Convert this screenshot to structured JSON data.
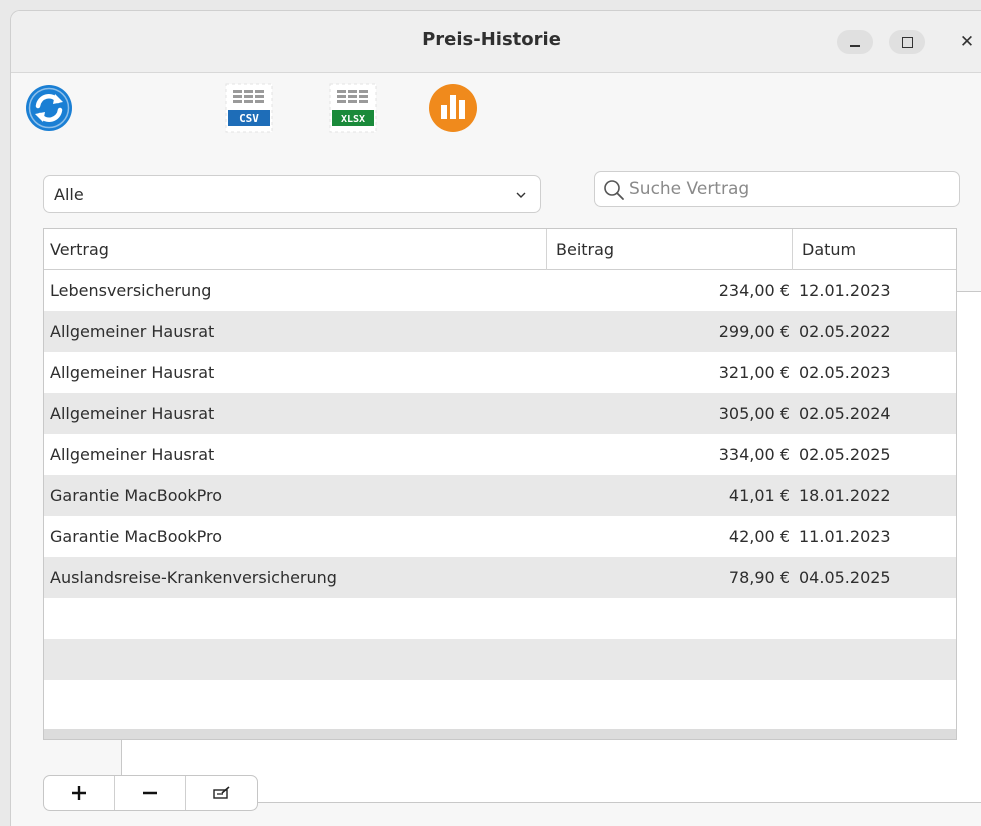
{
  "window": {
    "title": "Preis-Historie",
    "close_glyph": "✕"
  },
  "toolbar": {
    "buttons": [
      {
        "name": "refresh",
        "icon": "refresh-icon",
        "color": "#1a7fd4"
      },
      {
        "name": "table-view",
        "icon": "table-grid-icon",
        "color": "#2c6fd6"
      },
      {
        "name": "export-csv",
        "icon": "csv-export-icon",
        "label": "CSV",
        "color": "#1e6db8"
      },
      {
        "name": "export-xlsx",
        "icon": "xlsx-export-icon",
        "label": "XLSX",
        "color": "#1a8a3a"
      },
      {
        "name": "chart",
        "icon": "bar-chart-icon",
        "color": "#f08a1c"
      }
    ]
  },
  "filter": {
    "selected": "Alle"
  },
  "search": {
    "placeholder": "Suche Vertrag",
    "value": ""
  },
  "table": {
    "headers": [
      "Vertrag",
      "Beitrag",
      "Datum"
    ],
    "rows": [
      {
        "vertrag": "Lebensversicherung",
        "beitrag": "234,00 €",
        "datum": "12.01.2023"
      },
      {
        "vertrag": "Allgemeiner Hausrat",
        "beitrag": "299,00 €",
        "datum": "02.05.2022"
      },
      {
        "vertrag": "Allgemeiner Hausrat",
        "beitrag": "321,00 €",
        "datum": "02.05.2023"
      },
      {
        "vertrag": "Allgemeiner Hausrat",
        "beitrag": "305,00 €",
        "datum": "02.05.2024"
      },
      {
        "vertrag": "Allgemeiner Hausrat",
        "beitrag": "334,00 €",
        "datum": "02.05.2025"
      },
      {
        "vertrag": "Garantie MacBookPro",
        "beitrag": "41,01 €",
        "datum": "18.01.2022"
      },
      {
        "vertrag": "Garantie MacBookPro",
        "beitrag": "42,00 €",
        "datum": "11.01.2023"
      },
      {
        "vertrag": "Auslandsreise-Krankenversicherung",
        "beitrag": "78,90 €",
        "datum": "04.05.2025"
      }
    ],
    "empty_rows": 3
  },
  "actions": [
    {
      "name": "add",
      "icon": "plus-icon"
    },
    {
      "name": "remove",
      "icon": "minus-icon"
    },
    {
      "name": "edit",
      "icon": "edit-icon"
    }
  ]
}
